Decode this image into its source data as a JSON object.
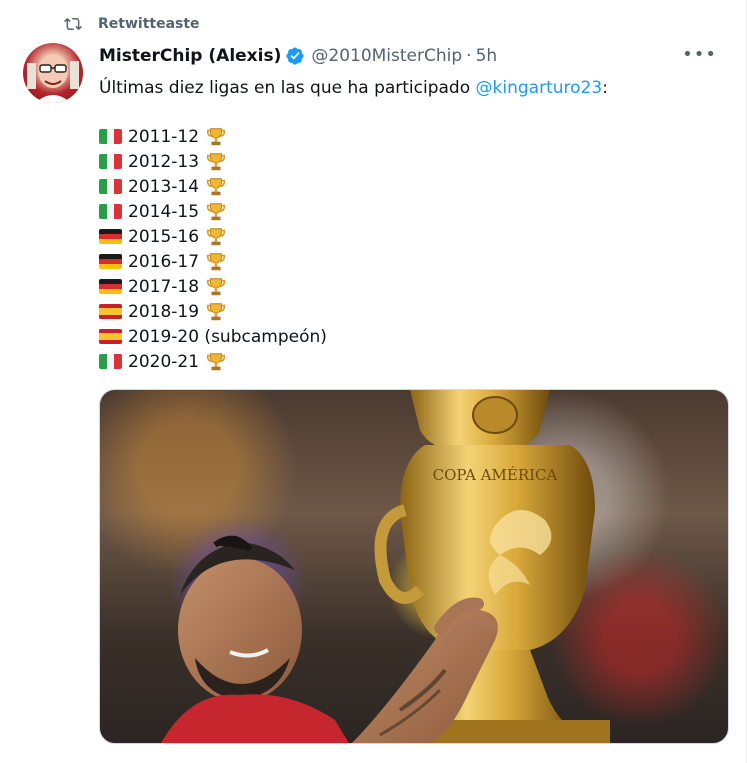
{
  "retweet": {
    "label": "Retwitteaste"
  },
  "tweet": {
    "author_name": "MisterChip (Alexis)",
    "handle": "@2010MisterChip",
    "separator": "·",
    "time": "5h",
    "more_label": "•••",
    "text_prefix": "Últimas diez ligas en las que ha participado ",
    "mention": "@kingarturo23",
    "text_suffix": ":",
    "seasons": [
      {
        "flag": "italy",
        "label": "2011-12",
        "trophy": true
      },
      {
        "flag": "italy",
        "label": "2012-13",
        "trophy": true
      },
      {
        "flag": "italy",
        "label": "2013-14",
        "trophy": true
      },
      {
        "flag": "italy",
        "label": "2014-15",
        "trophy": true
      },
      {
        "flag": "germany",
        "label": "2015-16",
        "trophy": true
      },
      {
        "flag": "germany",
        "label": "2016-17",
        "trophy": true
      },
      {
        "flag": "germany",
        "label": "2017-18",
        "trophy": true
      },
      {
        "flag": "spain",
        "label": "2018-19",
        "trophy": true
      },
      {
        "flag": "spain",
        "label": "2019-20 (subcampeón)",
        "trophy": false
      },
      {
        "flag": "italy",
        "label": "2020-21",
        "trophy": true
      }
    ]
  },
  "icons": {
    "retweet": "retweet-icon",
    "verified": "verified-badge-icon",
    "more": "more-options-icon",
    "trophy": "trophy-icon"
  },
  "colors": {
    "text": "#0f1419",
    "secondary": "#536471",
    "link": "#1d9bf0",
    "border": "#cfd9de"
  },
  "media": {
    "trophy_text": "COPA AMÉRICA"
  }
}
